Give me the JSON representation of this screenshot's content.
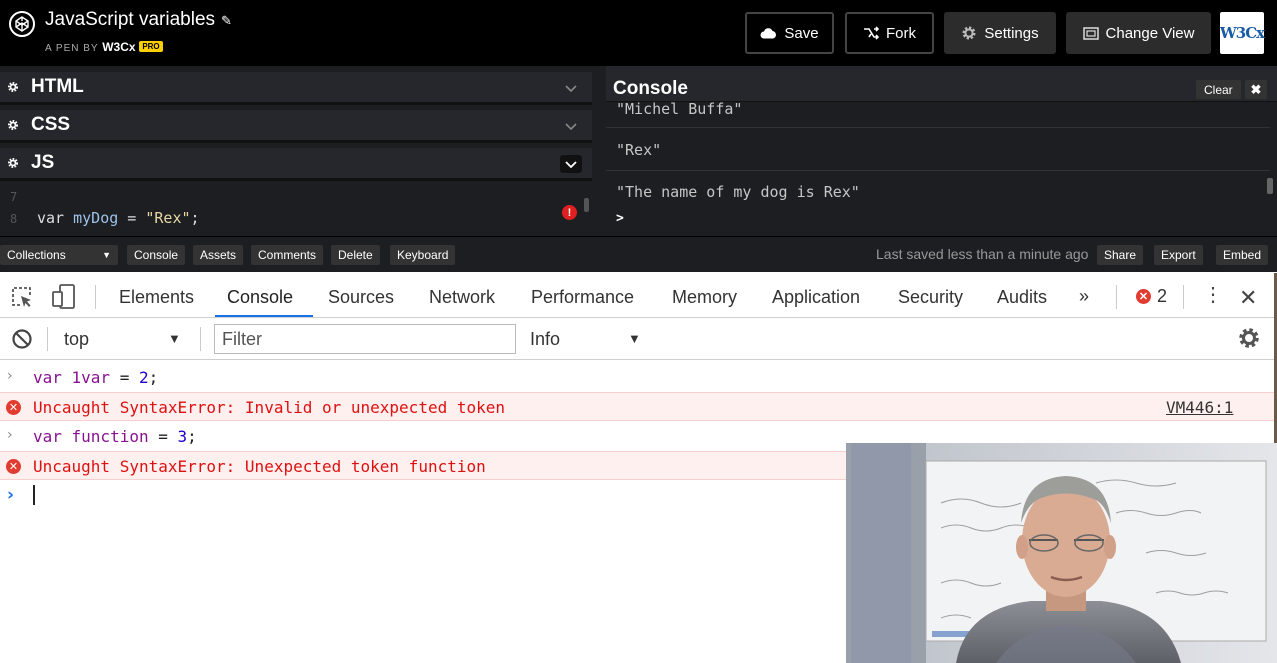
{
  "header": {
    "title": "JavaScript variables",
    "byline_prefix": "A PEN BY",
    "user": "W3Cx",
    "badge": "PRO",
    "buttons": {
      "save": "Save",
      "fork": "Fork",
      "settings": "Settings",
      "change_view": "Change View"
    },
    "logo_text": "W3Cx"
  },
  "editor": {
    "panels": [
      {
        "title": "HTML"
      },
      {
        "title": "CSS"
      },
      {
        "title": "JS"
      }
    ],
    "js_lines": [
      {
        "number": "8",
        "keyword": "var",
        "name": "myDog",
        "operator": " = ",
        "value": "\"Rex\"",
        "end": ";"
      }
    ]
  },
  "codepen_console": {
    "title": "Console",
    "clear_label": "Clear",
    "close_label": "✖",
    "lines": [
      "\"Michel Buffa\"",
      "\"Rex\"",
      "\"The name of my dog is Rex\""
    ],
    "prompt": ">"
  },
  "footer": {
    "collections": "Collections",
    "buttons": [
      "Console",
      "Assets",
      "Comments",
      "Delete",
      "Keyboard"
    ],
    "last_saved": "Last saved less than a minute ago",
    "right_buttons": [
      "Share",
      "Export",
      "Embed"
    ]
  },
  "devtools": {
    "tabs": [
      "Elements",
      "Console",
      "Sources",
      "Network",
      "Performance",
      "Memory",
      "Application",
      "Security",
      "Audits"
    ],
    "active_tab": "Console",
    "more": "»",
    "error_count": "2",
    "toolbar": {
      "context": "top",
      "filter_placeholder": "Filter",
      "level": "Info"
    },
    "log": [
      {
        "type": "input",
        "parts": [
          {
            "t": "var ",
            "c": "n-purple"
          },
          {
            "t": "1var",
            "c": "n-purple"
          },
          {
            "t": " = ",
            "c": "n-dark"
          },
          {
            "t": "2",
            "c": "n-blue"
          },
          {
            "t": ";",
            "c": "n-dark"
          }
        ]
      },
      {
        "type": "error",
        "text": "Uncaught SyntaxError: Invalid or unexpected token",
        "source": "VM446:1"
      },
      {
        "type": "input",
        "parts": [
          {
            "t": "var ",
            "c": "n-purple"
          },
          {
            "t": "function",
            "c": "n-purple"
          },
          {
            "t": " = ",
            "c": "n-dark"
          },
          {
            "t": "3",
            "c": "n-blue"
          },
          {
            "t": ";",
            "c": "n-dark"
          }
        ]
      },
      {
        "type": "error",
        "text": "Uncaught SyntaxError: Unexpected token function",
        "source": ""
      }
    ]
  },
  "colors": {
    "accent_blue": "#1a73e8",
    "error_red": "#d11111",
    "pro_yellow": "#fcd000"
  }
}
